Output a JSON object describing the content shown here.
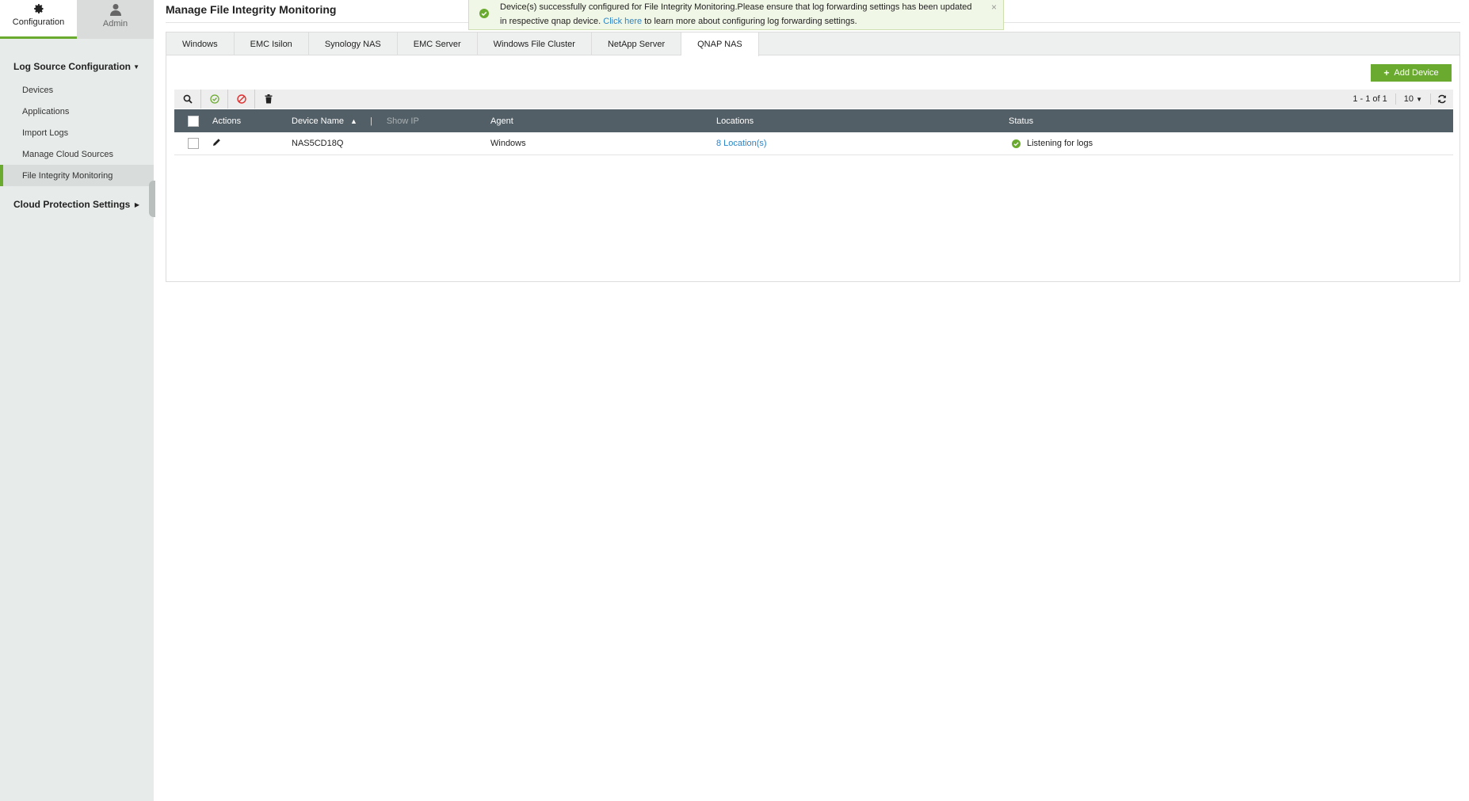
{
  "topnav": {
    "configuration": "Configuration",
    "admin": "Admin"
  },
  "sidebar": {
    "section1": "Log Source Configuration",
    "items": [
      "Devices",
      "Applications",
      "Import Logs",
      "Manage Cloud Sources",
      "File Integrity Monitoring"
    ],
    "section2": "Cloud Protection Settings"
  },
  "page": {
    "title": "Manage File Integrity Monitoring"
  },
  "toast": {
    "text_before": "Device(s) successfully configured for File Integrity Monitoring.Please ensure that log forwarding settings has been updated in respective qnap device.",
    "link": "Click here",
    "text_after": "to learn more about configuring log forwarding settings.",
    "close": "×"
  },
  "tabs": [
    "Windows",
    "EMC Isilon",
    "Synology NAS",
    "EMC Server",
    "Windows File Cluster",
    "NetApp Server",
    "QNAP NAS"
  ],
  "active_tab": "QNAP NAS",
  "add_device": "Add Device",
  "pagination": {
    "range": "1 - 1 of 1",
    "page_size": "10"
  },
  "table": {
    "headers": {
      "actions": "Actions",
      "device_name": "Device Name",
      "show_ip": "Show IP",
      "agent": "Agent",
      "locations": "Locations",
      "status": "Status"
    },
    "rows": [
      {
        "device_name": "NAS5CD18Q",
        "agent": "Windows",
        "locations": "8 Location(s)",
        "status": "Listening for logs"
      }
    ]
  },
  "colors": {
    "accent": "#6aaa2f",
    "header_bg": "#535f66",
    "link": "#2a85c9",
    "danger": "#e03030"
  }
}
